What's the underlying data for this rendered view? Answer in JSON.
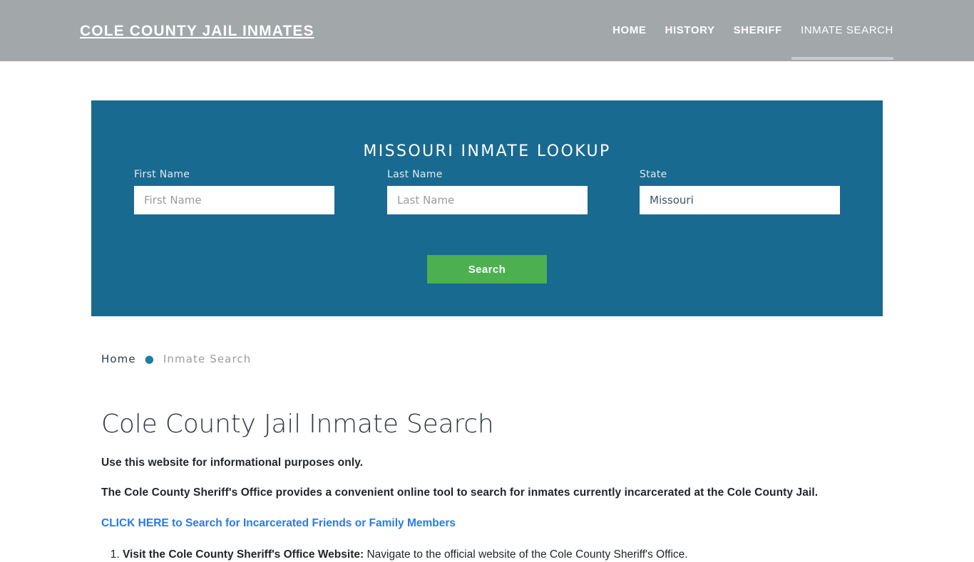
{
  "header": {
    "brand": "Cole County Jail Inmates",
    "nav": [
      {
        "label": "Home",
        "active": false
      },
      {
        "label": "History",
        "active": false
      },
      {
        "label": "Sheriff",
        "active": false
      },
      {
        "label": "Inmate Search",
        "active": true
      }
    ]
  },
  "lookup": {
    "title": "Missouri Inmate Lookup",
    "panel_color": "#196a90",
    "first_name": {
      "label": "First Name",
      "placeholder": "First Name",
      "value": ""
    },
    "last_name": {
      "label": "Last Name",
      "placeholder": "Last Name",
      "value": ""
    },
    "state": {
      "label": "State",
      "placeholder": "State",
      "value": "Missouri",
      "options": [
        "Missouri"
      ]
    },
    "search_label": "Search",
    "search_color": "#4cb050"
  },
  "breadcrumb": {
    "home": "Home",
    "separator": "●",
    "current": "Inmate Search"
  },
  "main": {
    "title": "Cole County Jail Inmate Search",
    "paragraph_1": "Use this website for informational purposes only.",
    "paragraph_2": "The Cole County Sheriff's Office provides a convenient online tool to search for inmates currently incarcerated at the Cole County Jail.",
    "cta_link": "CLICK HERE to Search for Incarcerated Friends or Family Members",
    "link_color": "#2a7ae8",
    "steps": [
      {
        "lead": "Visit the Cole County Sheriff's Office Website:",
        "text": " Navigate to the official website of the Cole County Sheriff's Office."
      }
    ]
  }
}
